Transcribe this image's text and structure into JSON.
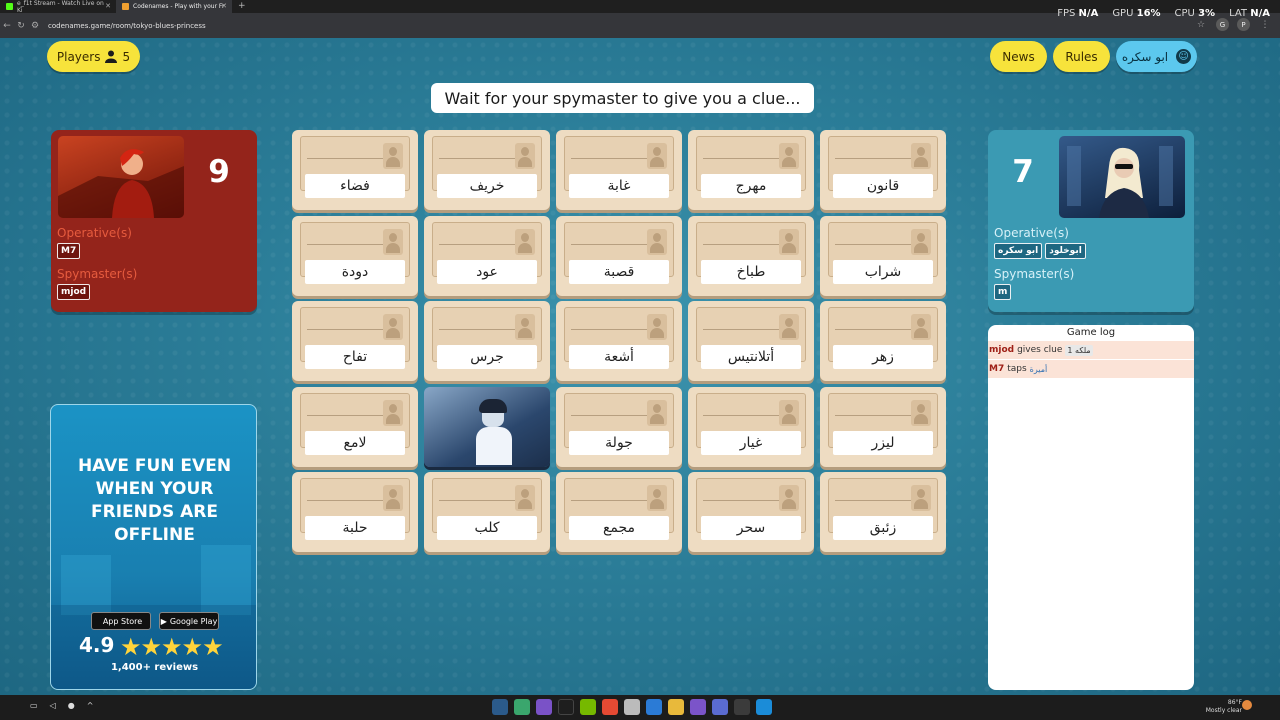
{
  "browser": {
    "tabs": [
      {
        "label": "e_f1t Stream - Watch Live on Ki",
        "active": false
      },
      {
        "label": "Codenames - Play with your Fr",
        "active": true
      }
    ],
    "new_tab": "+",
    "url": "codenames.game/room/tokyo-blues-princess"
  },
  "overlay": {
    "fps_label": "FPS",
    "fps": "N/A",
    "gpu_label": "GPU",
    "gpu": "16%",
    "cpu_label": "CPU",
    "cpu": "3%",
    "lat_label": "LAT",
    "lat": "N/A"
  },
  "header": {
    "players_label": "Players",
    "players_count": "5",
    "news": "News",
    "rules": "Rules",
    "username": "ابو سكره"
  },
  "status": "Wait for your spymaster to give you a clue...",
  "red_team": {
    "score": "9",
    "operatives_label": "Operative(s)",
    "operatives": [
      "M7"
    ],
    "spymasters_label": "Spymaster(s)",
    "spymasters": [
      "mjod"
    ]
  },
  "blue_team": {
    "score": "7",
    "operatives_label": "Operative(s)",
    "operatives": [
      "ابو سكره",
      "ابوخلود"
    ],
    "spymasters_label": "Spymaster(s)",
    "spymasters": [
      "m"
    ]
  },
  "board": {
    "cards": [
      {
        "word": "فضاء",
        "revealed": false
      },
      {
        "word": "خريف",
        "revealed": false
      },
      {
        "word": "غابة",
        "revealed": false
      },
      {
        "word": "مهرج",
        "revealed": false
      },
      {
        "word": "قانون",
        "revealed": false
      },
      {
        "word": "دودة",
        "revealed": false
      },
      {
        "word": "عود",
        "revealed": false
      },
      {
        "word": "قصبة",
        "revealed": false
      },
      {
        "word": "طباخ",
        "revealed": false
      },
      {
        "word": "شراب",
        "revealed": false
      },
      {
        "word": "تفاح",
        "revealed": false
      },
      {
        "word": "جرس",
        "revealed": false
      },
      {
        "word": "أشعة",
        "revealed": false
      },
      {
        "word": "أتلانتيس",
        "revealed": false
      },
      {
        "word": "زهر",
        "revealed": false
      },
      {
        "word": "لامع",
        "revealed": false
      },
      {
        "word": "",
        "revealed": true,
        "team": "blue"
      },
      {
        "word": "جولة",
        "revealed": false
      },
      {
        "word": "غيار",
        "revealed": false
      },
      {
        "word": "ليزر",
        "revealed": false
      },
      {
        "word": "حلبة",
        "revealed": false
      },
      {
        "word": "كلب",
        "revealed": false
      },
      {
        "word": "مجمع",
        "revealed": false
      },
      {
        "word": "سحر",
        "revealed": false
      },
      {
        "word": "زئبق",
        "revealed": false
      }
    ]
  },
  "ad": {
    "title": "HAVE FUN EVEN\nWHEN YOUR\nFRIENDS ARE\nOFFLINE",
    "app_store": "App Store",
    "google_play": "Google Play",
    "rating": "4.9",
    "stars": "★★★★★",
    "reviews": "1,400+ reviews"
  },
  "game_log": {
    "title": "Game log",
    "entries": [
      {
        "player": "mjod",
        "action": "gives clue",
        "clue": "ملكه 1"
      },
      {
        "player": "M7",
        "action": "taps",
        "word": "أميرة"
      }
    ]
  },
  "taskbar": {
    "weather": "86°F",
    "weather_desc": "Mostly clear"
  }
}
